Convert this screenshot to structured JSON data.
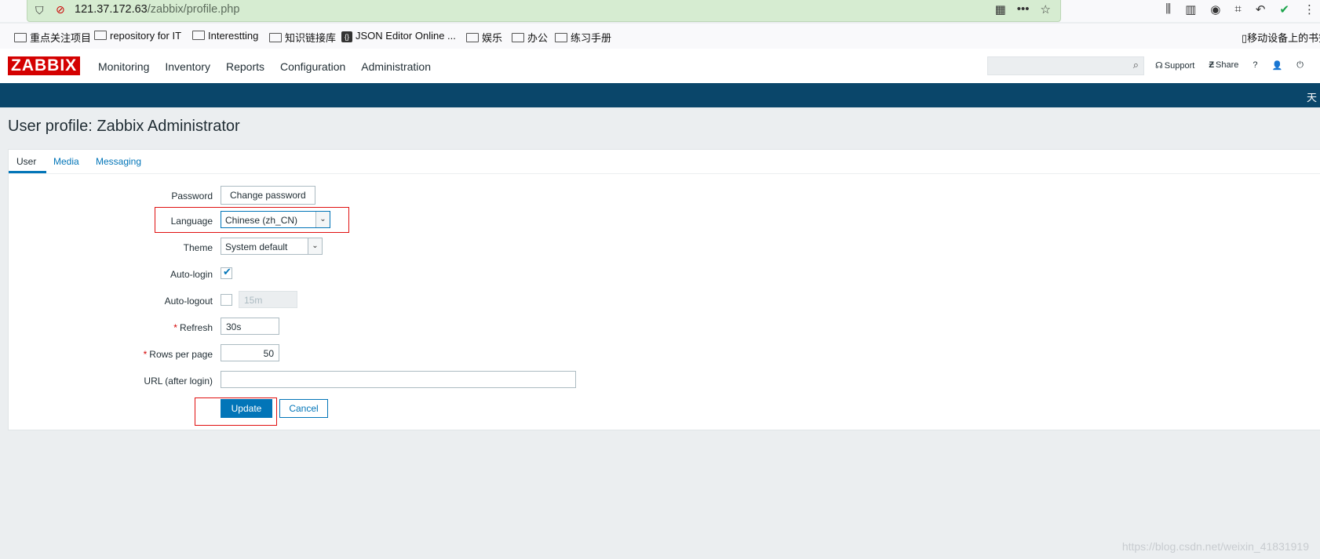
{
  "browser": {
    "url_host": "121.37.172.63",
    "url_path": "/zabbix/profile.php",
    "bookmarks": [
      {
        "label": "重点关注项目",
        "icon": "folder-icon"
      },
      {
        "label": "repository for IT",
        "icon": "folder-icon"
      },
      {
        "label": "Interestting",
        "icon": "folder-icon"
      },
      {
        "label": "知识链接库",
        "icon": "folder-icon"
      },
      {
        "label": "JSON Editor Online ...",
        "icon": "json-icon"
      },
      {
        "label": "娱乐",
        "icon": "folder-icon"
      },
      {
        "label": "办公",
        "icon": "folder-icon"
      },
      {
        "label": "练习手册",
        "icon": "folder-icon"
      }
    ],
    "mobile_bookmarks": "移动设备上的书签"
  },
  "header": {
    "logo": "ZABBIX",
    "nav": [
      "Monitoring",
      "Inventory",
      "Reports",
      "Configuration",
      "Administration"
    ],
    "support": "Support",
    "share": "Share",
    "help": "?",
    "subbar_text": "天"
  },
  "page": {
    "title": "User profile: Zabbix Administrator",
    "tabs": [
      "User",
      "Media",
      "Messaging"
    ],
    "form": {
      "password_label": "Password",
      "change_password": "Change password",
      "language_label": "Language",
      "language_value": "Chinese (zh_CN)",
      "theme_label": "Theme",
      "theme_value": "System default",
      "autologin_label": "Auto-login",
      "autologin_checked": true,
      "autologout_label": "Auto-logout",
      "autologout_checked": false,
      "autologout_value": "15m",
      "refresh_label": "Refresh",
      "refresh_value": "30s",
      "rows_label": "Rows per page",
      "rows_value": "50",
      "url_label": "URL (after login)",
      "url_value": "",
      "required_mark": "*",
      "update": "Update",
      "cancel": "Cancel"
    }
  },
  "watermark": "https://blog.csdn.net/weixin_41831919",
  "colors": {
    "accent": "#0275b8",
    "header_bar": "#0a466a",
    "logo": "#d40000",
    "highlight_box": "#e01010"
  }
}
